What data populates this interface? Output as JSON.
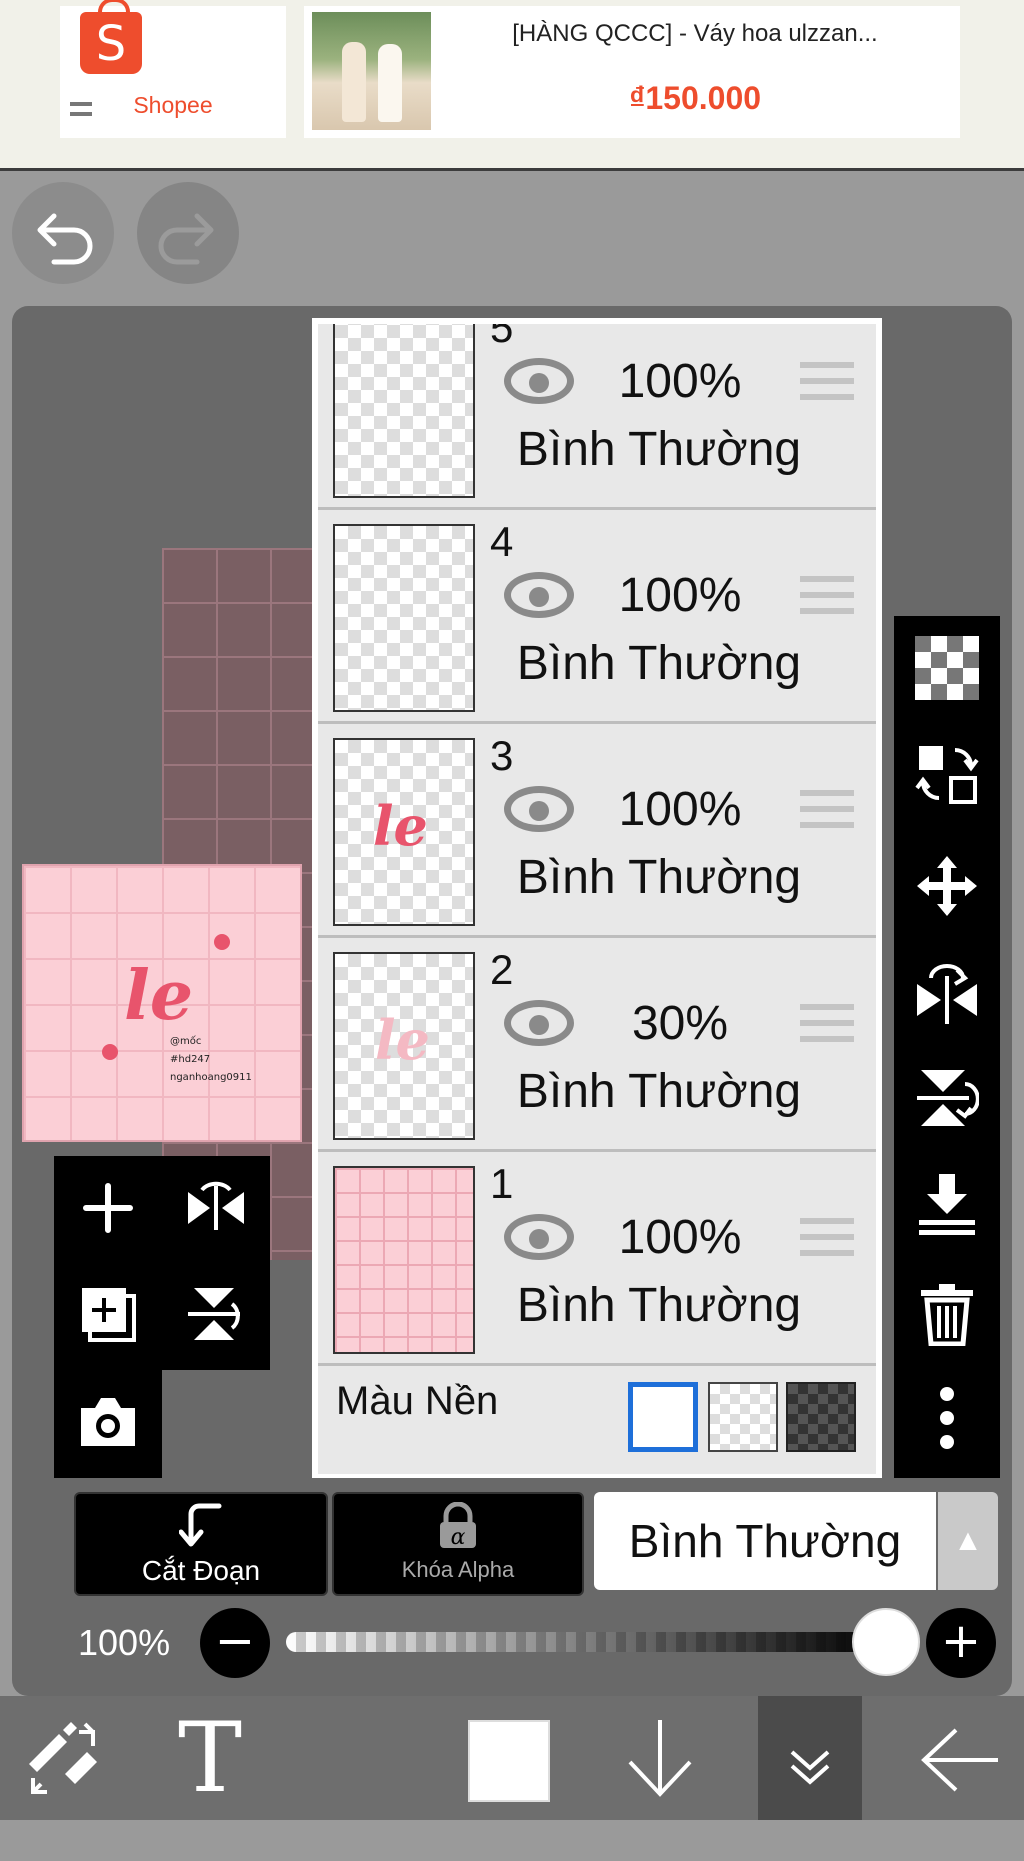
{
  "ad": {
    "brand": "Shopee",
    "product_title": "[HÀNG QCCC] - Váy hoa ulzzan...",
    "price": "₫150.000"
  },
  "history": {
    "undo_icon": "undo-icon",
    "redo_icon": "redo-icon"
  },
  "preview": {
    "art_text": "le",
    "line1": "@mốc",
    "line2": "#hd247",
    "line3": "nganhoang0911"
  },
  "layers": [
    {
      "number": "5",
      "opacity": "100%",
      "mode": "Bình Thường"
    },
    {
      "number": "4",
      "opacity": "100%",
      "mode": "Bình Thường"
    },
    {
      "number": "3",
      "opacity": "100%",
      "mode": "Bình Thường"
    },
    {
      "number": "2",
      "opacity": "30%",
      "mode": "Bình Thường"
    },
    {
      "number": "1",
      "opacity": "100%",
      "mode": "Bình Thường"
    }
  ],
  "background": {
    "label": "Màu Nền",
    "options": [
      "white",
      "transparent",
      "dark-checker"
    ],
    "selected": "white"
  },
  "controls": {
    "clipping_label": "Cắt Đoạn",
    "alpha_lock_label": "Khóa Alpha",
    "blend_mode": "Bình Thường",
    "opacity_label": "100%",
    "opacity_value": 100
  },
  "colors": {
    "accent": "#1e6fd9",
    "shopee": "#ee4d2d",
    "toolbar": "#6e6e6e"
  }
}
